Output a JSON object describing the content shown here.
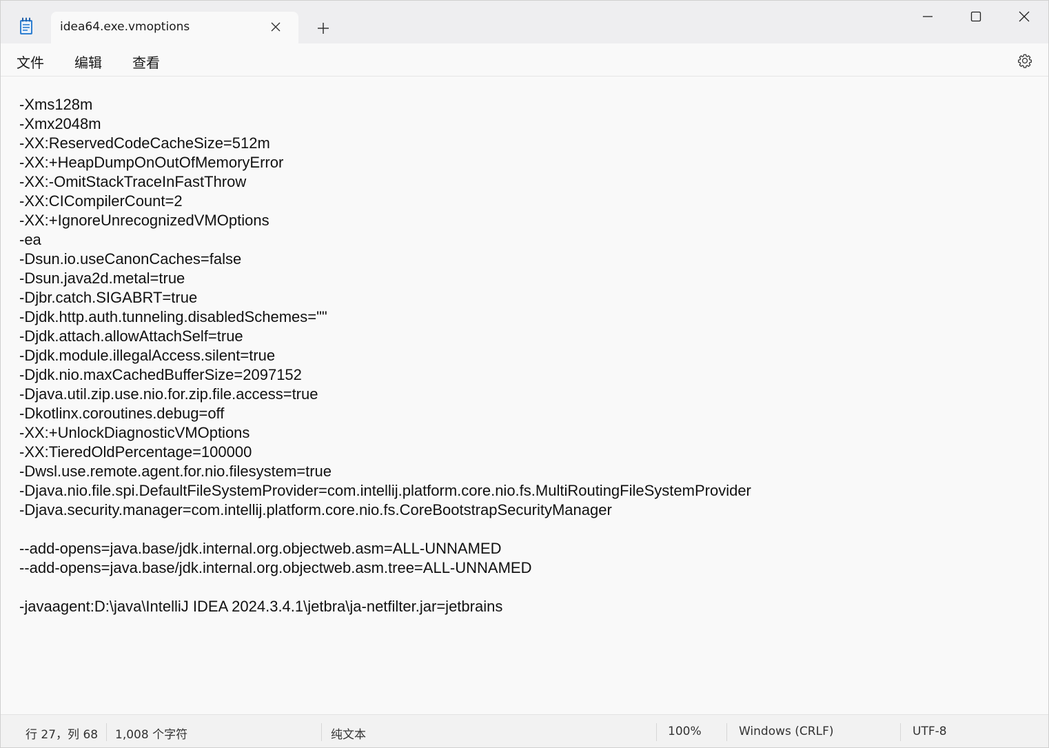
{
  "tab": {
    "title": "idea64.exe.vmoptions"
  },
  "menu": {
    "file": "文件",
    "edit": "编辑",
    "view": "查看"
  },
  "icons": {
    "app": "notepad-icon",
    "close_tab": "close-icon",
    "new_tab": "plus-icon",
    "minimize": "minimize-icon",
    "maximize": "maximize-icon",
    "close_window": "close-icon",
    "settings": "gear-icon"
  },
  "content": {
    "lines": [
      "-Xms128m",
      "-Xmx2048m",
      "-XX:ReservedCodeCacheSize=512m",
      "-XX:+HeapDumpOnOutOfMemoryError",
      "-XX:-OmitStackTraceInFastThrow",
      "-XX:CICompilerCount=2",
      "-XX:+IgnoreUnrecognizedVMOptions",
      "-ea",
      "-Dsun.io.useCanonCaches=false",
      "-Dsun.java2d.metal=true",
      "-Djbr.catch.SIGABRT=true",
      "-Djdk.http.auth.tunneling.disabledSchemes=\"\"",
      "-Djdk.attach.allowAttachSelf=true",
      "-Djdk.module.illegalAccess.silent=true",
      "-Djdk.nio.maxCachedBufferSize=2097152",
      "-Djava.util.zip.use.nio.for.zip.file.access=true",
      "-Dkotlinx.coroutines.debug=off",
      "-XX:+UnlockDiagnosticVMOptions",
      "-XX:TieredOldPercentage=100000",
      "-Dwsl.use.remote.agent.for.nio.filesystem=true",
      "-Djava.nio.file.spi.DefaultFileSystemProvider=com.intellij.platform.core.nio.fs.MultiRoutingFileSystemProvider",
      "-Djava.security.manager=com.intellij.platform.core.nio.fs.CoreBootstrapSecurityManager",
      "",
      "--add-opens=java.base/jdk.internal.org.objectweb.asm=ALL-UNNAMED",
      "--add-opens=java.base/jdk.internal.org.objectweb.asm.tree=ALL-UNNAMED",
      "",
      "-javaagent:D:\\java\\IntelliJ IDEA 2024.3.4.1\\jetbra\\ja-netfilter.jar=jetbrains"
    ]
  },
  "status": {
    "position": "行 27，列 68",
    "char_count": "1,008 个字符",
    "format": "纯文本",
    "zoom": "100%",
    "line_ending": "Windows (CRLF)",
    "encoding": "UTF-8"
  }
}
